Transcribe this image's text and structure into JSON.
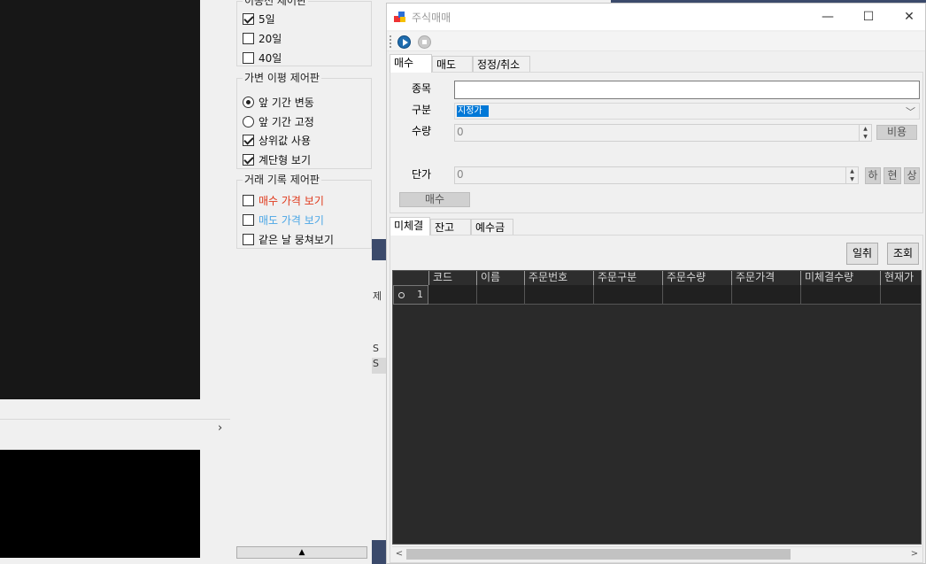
{
  "control_panel": {
    "period_group": {
      "title": "이동선 제어판",
      "options": [
        {
          "label": "5일",
          "checked": true
        },
        {
          "label": "20일",
          "checked": false
        },
        {
          "label": "40일",
          "checked": false
        }
      ]
    },
    "envelope_group": {
      "title": "가변 이평 제어판",
      "options": [
        {
          "label": "앞 기간 변동",
          "type": "radio",
          "checked": true
        },
        {
          "label": "앞 기간 고정",
          "type": "radio",
          "checked": false
        },
        {
          "label": "상위값 사용",
          "type": "checkbox",
          "checked": true
        },
        {
          "label": "계단형 보기",
          "type": "checkbox",
          "checked": true
        }
      ]
    },
    "trade_group": {
      "title": "거래 기록 제어판",
      "options": [
        {
          "label": "매수 가격 보기",
          "checked": false,
          "color": "#e0381a"
        },
        {
          "label": "매도 가격 보기",
          "checked": false,
          "color": "#4aa6e6"
        },
        {
          "label": "같은 날 뭉쳐보기",
          "checked": false,
          "color": "#111111"
        }
      ]
    },
    "scroll_button": "▲"
  },
  "mid_strip": {
    "char": "제",
    "s1": "S",
    "s2": "S"
  },
  "left_chevron": "›",
  "window": {
    "title": "주식매매",
    "minimize": "—",
    "maximize": "☐",
    "close": "✕"
  },
  "tabs_top": {
    "buy": "매수",
    "sell": "매도",
    "modify": "정정/취소"
  },
  "order_form": {
    "stock_label": "종목",
    "stock_value": "",
    "type_label": "구분",
    "type_value": "지정가",
    "qty_label": "수량",
    "qty_value": "0",
    "cost_button": "비용",
    "price_label": "단가",
    "price_value": "0",
    "low_button": "하",
    "cur_button": "현",
    "up_button": "상",
    "submit_button": "매수"
  },
  "tabs_bottom": {
    "unfilled": "미체결",
    "balance": "잔고",
    "deposit": "예수금"
  },
  "list_buttons": {
    "cancel_all": "일취",
    "query": "조회"
  },
  "grid": {
    "columns": [
      "코드",
      "이름",
      "주문번호",
      "주문구분",
      "주문수량",
      "주문가격",
      "미체결수량",
      "현재가"
    ],
    "rows": [
      {
        "num": "1"
      }
    ]
  },
  "colors": {
    "accent": "#0078d7",
    "play": "#1e6cae",
    "dark_bg": "#171717"
  }
}
